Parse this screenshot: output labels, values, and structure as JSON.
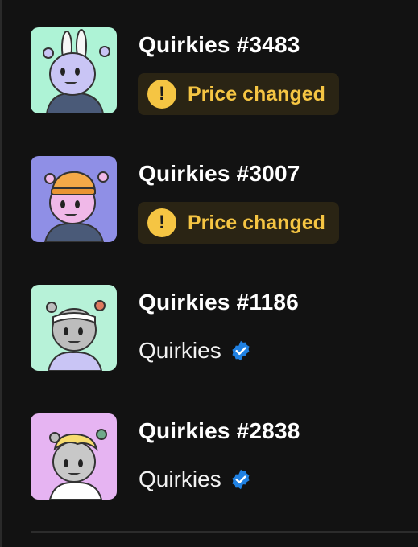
{
  "items": [
    {
      "title": "Quirkies #3483",
      "status": "Price changed",
      "bg": "#aef3d6",
      "char": "#c9c5f5",
      "hat": "bunny"
    },
    {
      "title": "Quirkies #3007",
      "status": "Price changed",
      "bg": "#8f8fe6",
      "char": "#f0b8e8",
      "hat": "beanie"
    },
    {
      "title": "Quirkies #1186",
      "collection": "Quirkies",
      "bg": "#b7f2d8",
      "char": "#bdbdbd",
      "hat": "headband"
    },
    {
      "title": "Quirkies #2838",
      "collection": "Quirkies",
      "bg": "#e6b4f2",
      "char": "#c8c8c8",
      "hat": "hair"
    }
  ],
  "colors": {
    "background": "#121212",
    "warning": "#f5c543",
    "warning_bg": "#2a2414",
    "verified": "#2081e2"
  },
  "icons": {
    "warning": "exclamation-circle-icon",
    "verified": "verified-badge-icon"
  }
}
